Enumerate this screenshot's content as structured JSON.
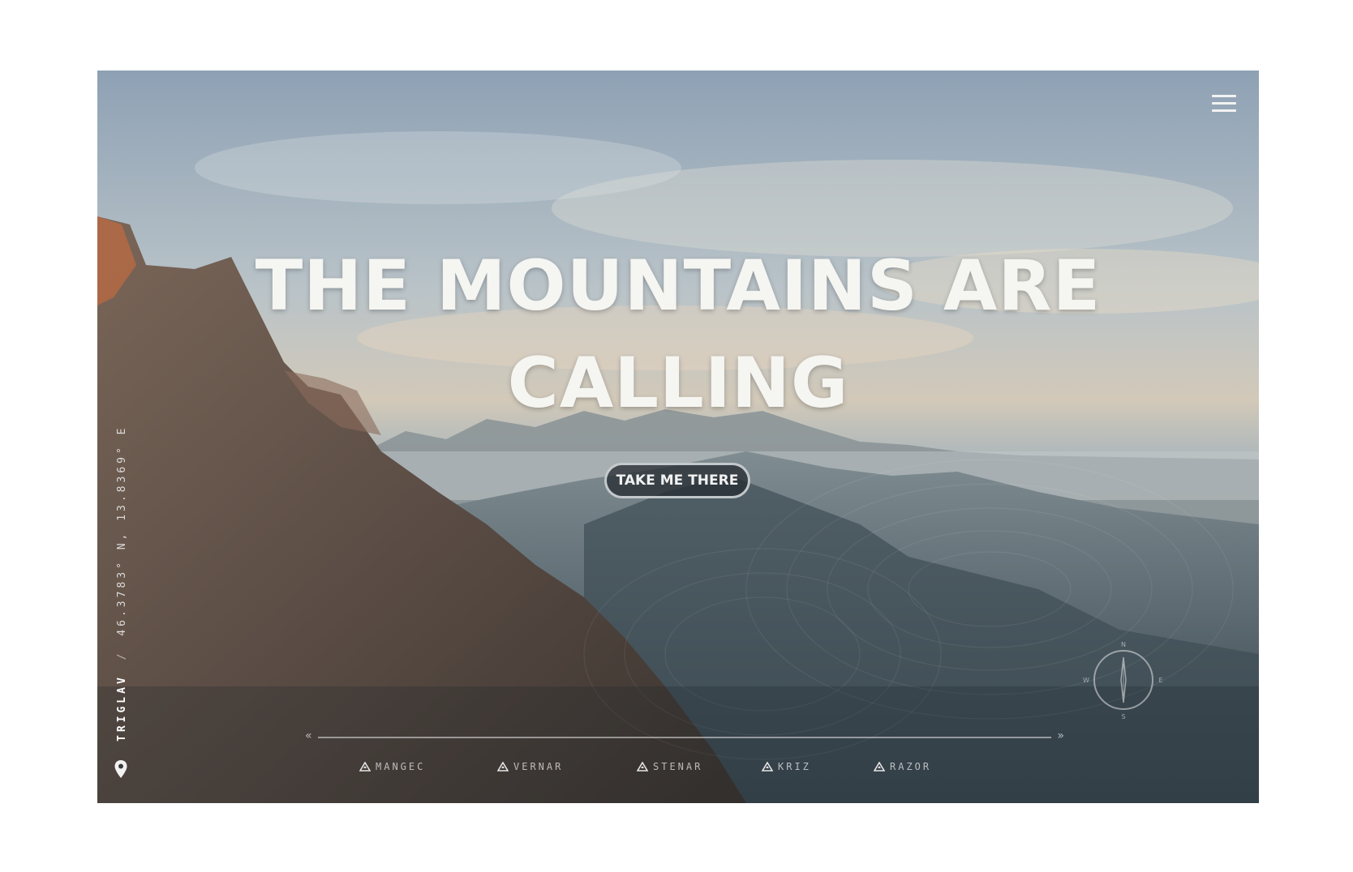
{
  "hero": {
    "headline_line1": "THE MOUNTAINS ARE",
    "headline_line2": "CALLING",
    "cta_label": "TAKE ME THERE"
  },
  "header": {
    "menu_icon": "hamburger-menu-icon"
  },
  "location": {
    "icon": "map-pin-icon",
    "place": "TRIGLAV",
    "coordinates": "46.3783° N, 13.8369° E"
  },
  "timeline": {
    "peaks": [
      {
        "label": "MANGEC",
        "icon": "mountain-icon"
      },
      {
        "label": "VERNAR",
        "icon": "mountain-icon"
      },
      {
        "label": "STENAR",
        "icon": "mountain-icon"
      },
      {
        "label": "KRIZ",
        "icon": "mountain-icon"
      },
      {
        "label": "RAZOR",
        "icon": "mountain-icon"
      }
    ]
  },
  "compass": {
    "icon": "compass-icon",
    "north": "N",
    "south": "S",
    "east": "E",
    "west": "W"
  }
}
